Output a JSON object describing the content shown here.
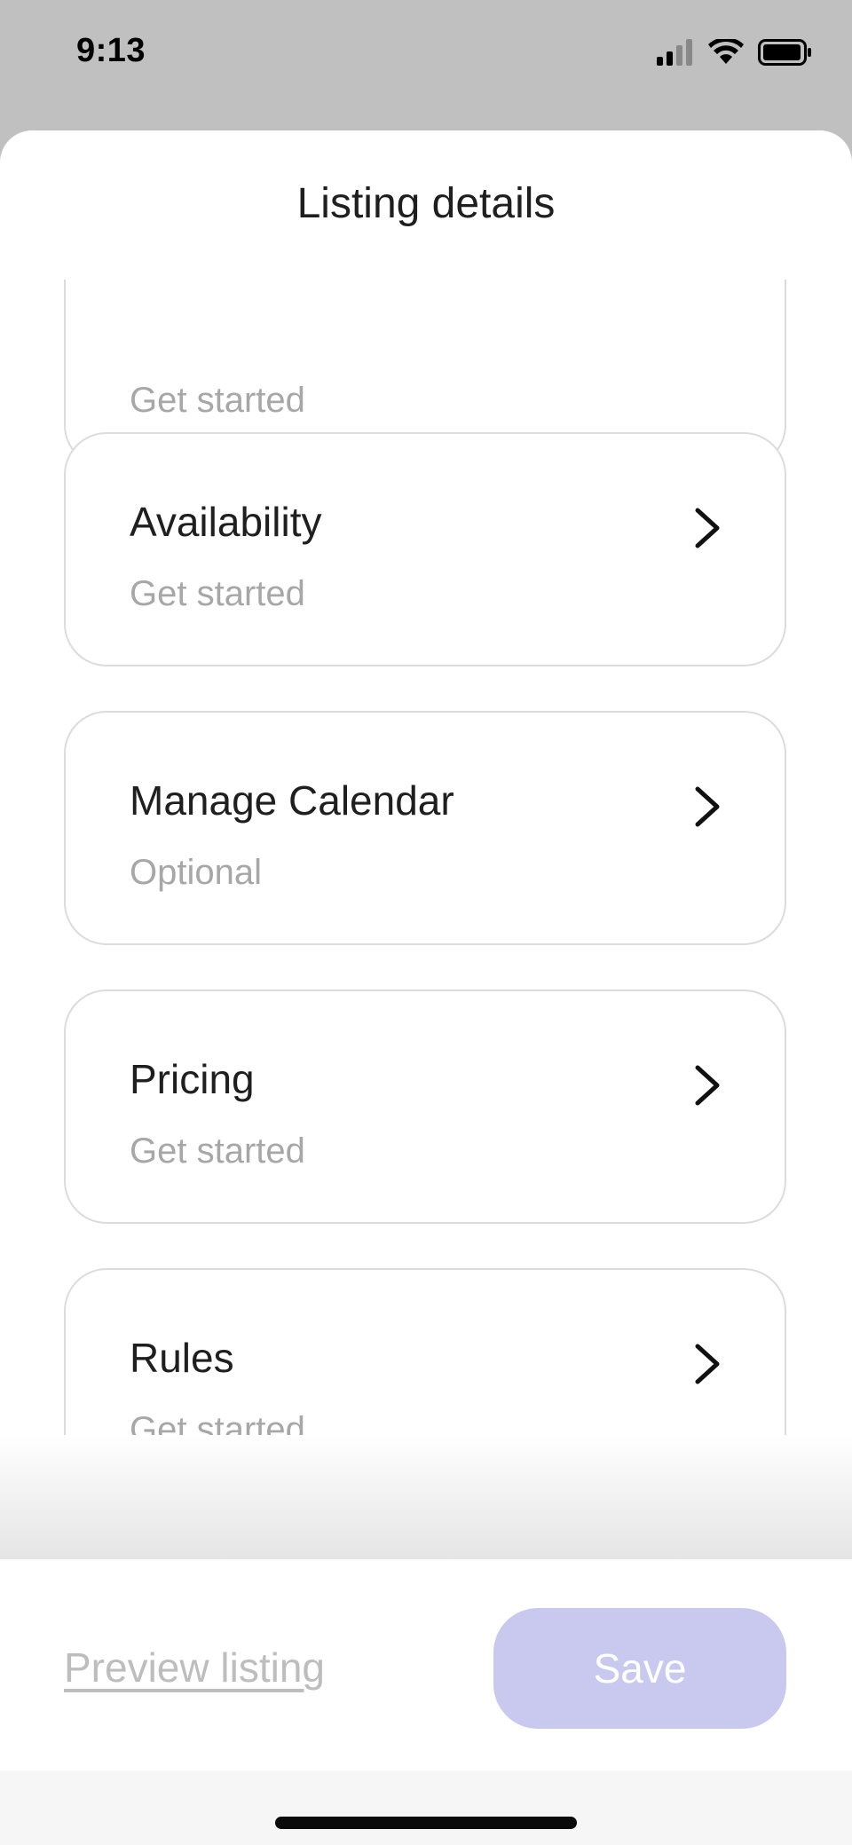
{
  "status": {
    "time": "9:13"
  },
  "sheet": {
    "title": "Listing details"
  },
  "cards": [
    {
      "title": "",
      "subtitle": "Get started"
    },
    {
      "title": "Availability",
      "subtitle": "Get started"
    },
    {
      "title": "Manage Calendar",
      "subtitle": "Optional"
    },
    {
      "title": "Pricing",
      "subtitle": "Get started"
    },
    {
      "title": "Rules",
      "subtitle": "Get started"
    }
  ],
  "footer": {
    "preview_label": "Preview listing",
    "save_label": "Save"
  },
  "colors": {
    "save_button": "#c9c9f0",
    "muted_text": "#a7a7a7",
    "card_border": "#dcdcdc"
  }
}
